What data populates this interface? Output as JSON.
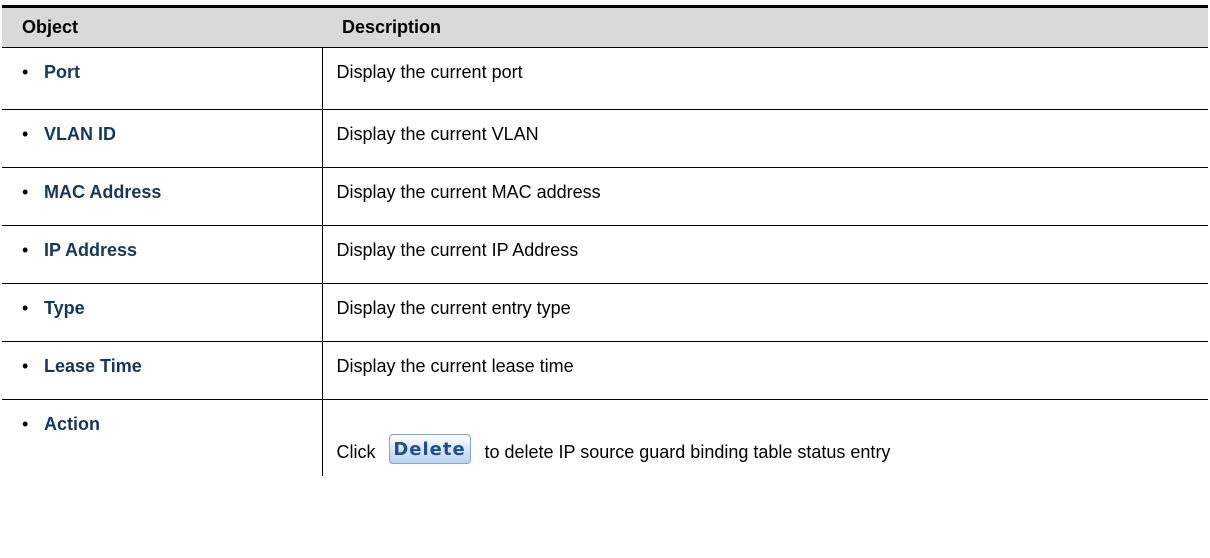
{
  "table": {
    "headers": {
      "object": "Object",
      "description": "Description"
    },
    "rows": [
      {
        "bullet": "•",
        "object": "Port",
        "description": "Display the current port"
      },
      {
        "bullet": "•",
        "object": "VLAN ID",
        "description": "Display the current VLAN"
      },
      {
        "bullet": "•",
        "object": "MAC Address",
        "description": "Display the current MAC address"
      },
      {
        "bullet": "•",
        "object": "IP Address",
        "description": "Display the current IP Address"
      },
      {
        "bullet": "•",
        "object": "Type",
        "description": "Display the current entry type"
      },
      {
        "bullet": "•",
        "object": "Lease Time",
        "description": "Display the current lease time"
      }
    ],
    "action_row": {
      "bullet": "•",
      "object": "Action",
      "prefix": "Click",
      "button_label": "Delete",
      "suffix": "to delete IP source guard binding table status entry"
    }
  },
  "colors": {
    "object_text": "#17365d",
    "header_bg": "#d9d9d9",
    "button_text": "#1f4e8c",
    "button_border": "#7ea6d3"
  }
}
